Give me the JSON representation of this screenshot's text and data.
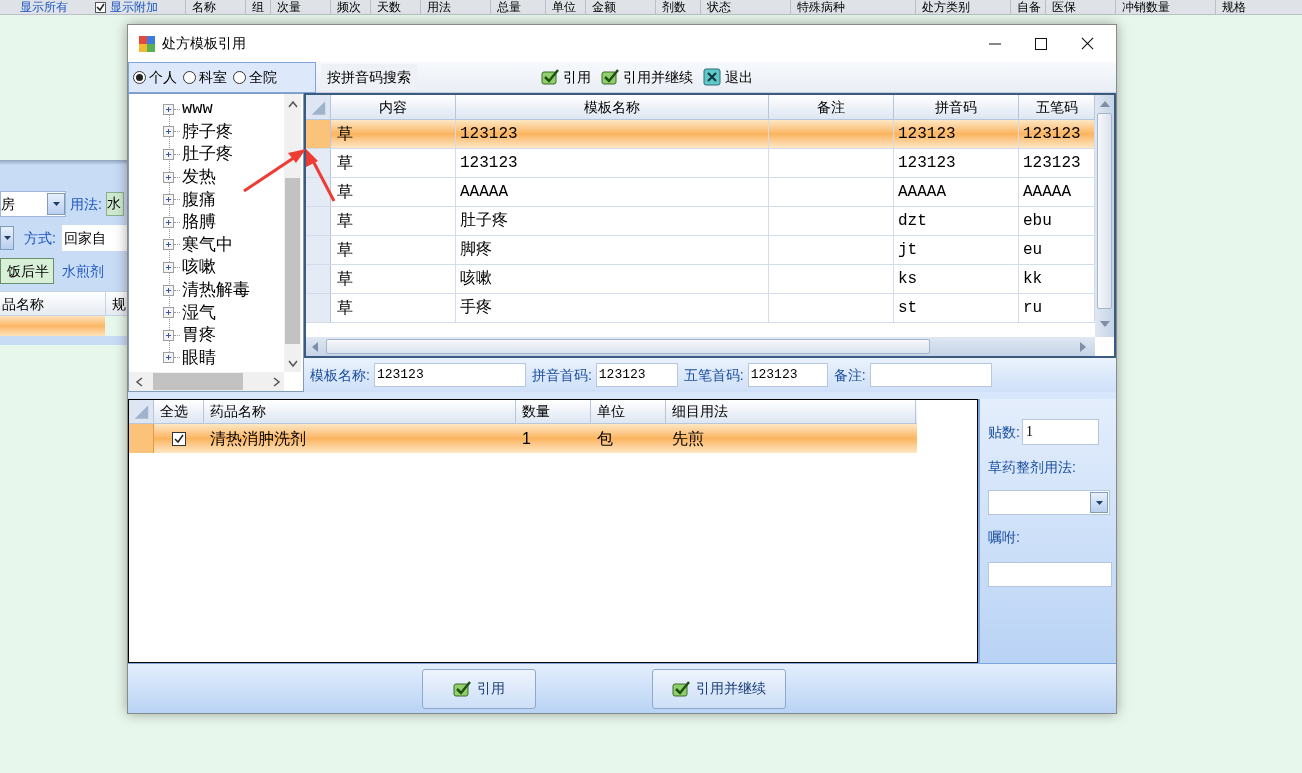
{
  "background": {
    "header": [
      {
        "label": "显示所有",
        "kind": "link"
      },
      {
        "label": "显示附加",
        "kind": "checkbox",
        "checked": true
      },
      {
        "label": "名称",
        "kind": "column"
      },
      {
        "label": "组",
        "kind": "column"
      },
      {
        "label": "次量",
        "kind": "column"
      },
      {
        "label": "频次",
        "kind": "column"
      },
      {
        "label": "天数",
        "kind": "column"
      },
      {
        "label": "用法",
        "kind": "column"
      },
      {
        "label": "总量",
        "kind": "column"
      },
      {
        "label": "单位",
        "kind": "column"
      },
      {
        "label": "金额",
        "kind": "column"
      },
      {
        "label": "剂数",
        "kind": "column"
      },
      {
        "label": "状态",
        "kind": "column"
      },
      {
        "label": "特殊病种",
        "kind": "column"
      },
      {
        "label": "处方类别",
        "kind": "column"
      },
      {
        "label": "自备",
        "kind": "column"
      },
      {
        "label": "医保",
        "kind": "column"
      },
      {
        "label": "冲销数量",
        "kind": "column"
      },
      {
        "label": "规格",
        "kind": "column"
      }
    ],
    "pharmacy_value": "房",
    "usage_label": "用法:",
    "usage_value": "水",
    "method_label": "方式:",
    "method_value": "回家自",
    "timing_button": "饭后半",
    "form_text": "水煎剂",
    "columns": [
      "品名称",
      "规"
    ]
  },
  "window": {
    "title": "处方模板引用",
    "scope_options": [
      {
        "label": "个人",
        "selected": true
      },
      {
        "label": "科室",
        "selected": false
      },
      {
        "label": "全院",
        "selected": false
      }
    ],
    "search_button": "按拼音码搜索",
    "toolbar": [
      {
        "label": "引用",
        "kind": "confirm"
      },
      {
        "label": "引用并继续",
        "kind": "confirm"
      },
      {
        "label": "退出",
        "kind": "exit"
      }
    ]
  },
  "tree": {
    "items": [
      {
        "label": "www"
      },
      {
        "label": "脖子疼"
      },
      {
        "label": "肚子疼"
      },
      {
        "label": "发热"
      },
      {
        "label": "腹痛"
      },
      {
        "label": "胳膊"
      },
      {
        "label": "寒气中"
      },
      {
        "label": "咳嗽"
      },
      {
        "label": "清热解毒"
      },
      {
        "label": "湿气"
      },
      {
        "label": "胃疼"
      },
      {
        "label": "眼睛"
      }
    ]
  },
  "template_grid": {
    "columns": [
      "内容",
      "模板名称",
      "备注",
      "拼音码",
      "五笔码"
    ],
    "rows": [
      {
        "selected": true,
        "cells": [
          "草",
          "123123",
          "",
          "123123",
          "123123"
        ]
      },
      {
        "selected": false,
        "cells": [
          "草",
          "123123",
          "",
          "123123",
          "123123"
        ]
      },
      {
        "selected": false,
        "cells": [
          "草",
          "AAAAA",
          "",
          "AAAAA",
          "AAAAA"
        ]
      },
      {
        "selected": false,
        "cells": [
          "草",
          "肚子疼",
          "",
          "dzt",
          "ebu"
        ]
      },
      {
        "selected": false,
        "cells": [
          "草",
          "脚疼",
          "",
          "jt",
          "eu"
        ]
      },
      {
        "selected": false,
        "cells": [
          "草",
          "咳嗽",
          "",
          "ks",
          "kk"
        ]
      },
      {
        "selected": false,
        "cells": [
          "草",
          "手疼",
          "",
          "st",
          "ru"
        ]
      }
    ]
  },
  "template_form": {
    "fields": [
      {
        "label": "模板名称:",
        "value": "123123"
      },
      {
        "label": "拼音首码:",
        "value": "123123"
      },
      {
        "label": "五笔首码:",
        "value": "123123"
      },
      {
        "label": "备注:"
      }
    ]
  },
  "drug_grid": {
    "select_all": "全选",
    "columns": [
      "药品名称",
      "数量",
      "单位",
      "细目用法"
    ],
    "rows": [
      {
        "selected": true,
        "checked": true,
        "cells": [
          "清热消肿洗剂",
          "1",
          "包",
          "先煎"
        ]
      }
    ]
  },
  "side_panel": {
    "fields": [
      {
        "kind": "text",
        "label": "贴数:",
        "value": "1"
      },
      {
        "kind": "dropdown",
        "label": "草药整剂用法:"
      },
      {
        "kind": "text",
        "label": "嘱咐:"
      }
    ]
  },
  "footer_buttons": [
    "引用",
    "引用并继续"
  ]
}
